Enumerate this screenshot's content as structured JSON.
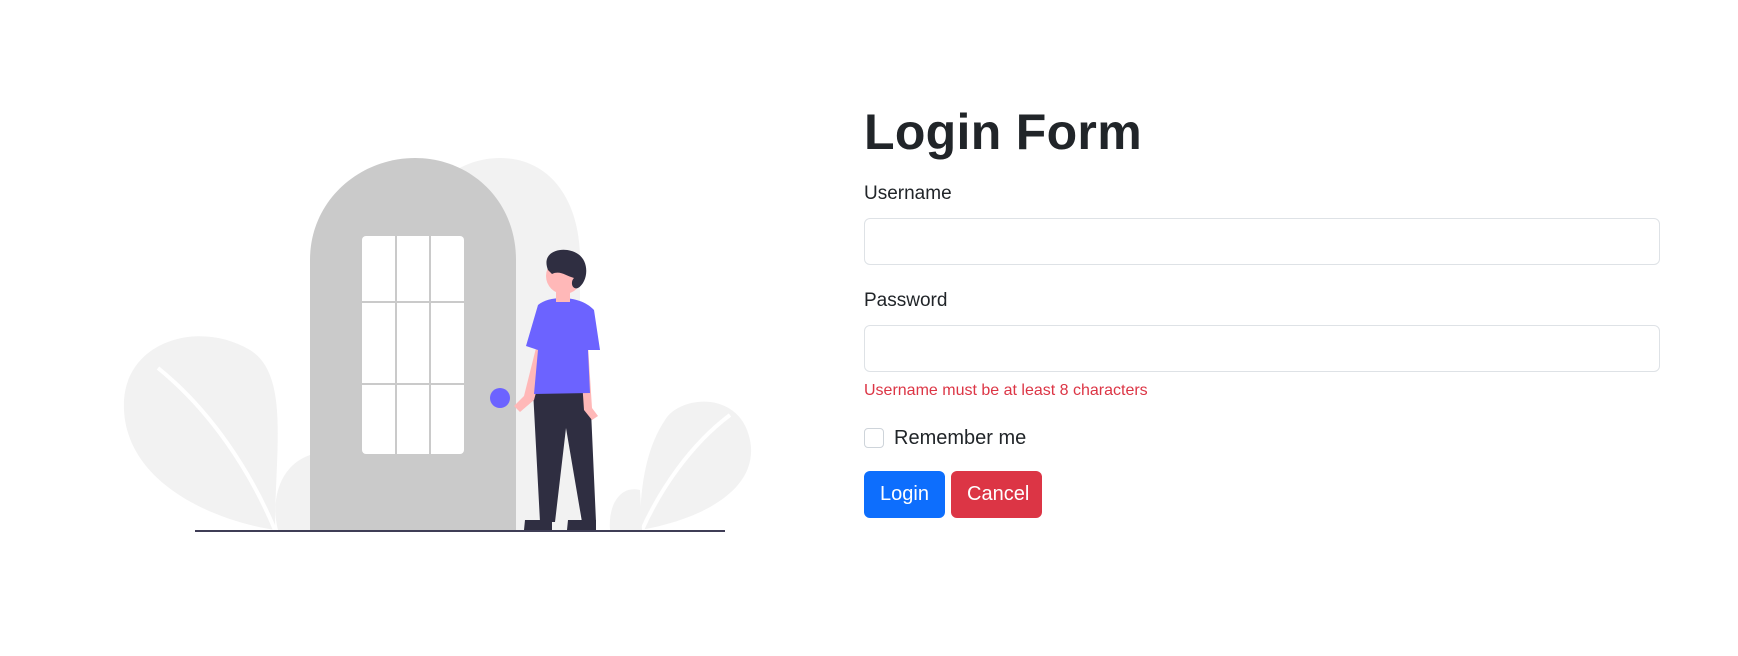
{
  "form": {
    "title": "Login Form",
    "username_label": "Username",
    "username_value": "",
    "password_label": "Password",
    "password_value": "",
    "error_message": "Username must be at least 8 characters",
    "remember_label": "Remember me",
    "remember_checked": false,
    "login_label": "Login",
    "cancel_label": "Cancel"
  },
  "colors": {
    "primary": "#0d6efd",
    "danger": "#dc3545",
    "illustration_accent": "#6c63ff",
    "door": "#cacaca",
    "foliage": "#f2f2f2"
  },
  "illustration": {
    "icon": "person-at-door-illustration"
  }
}
